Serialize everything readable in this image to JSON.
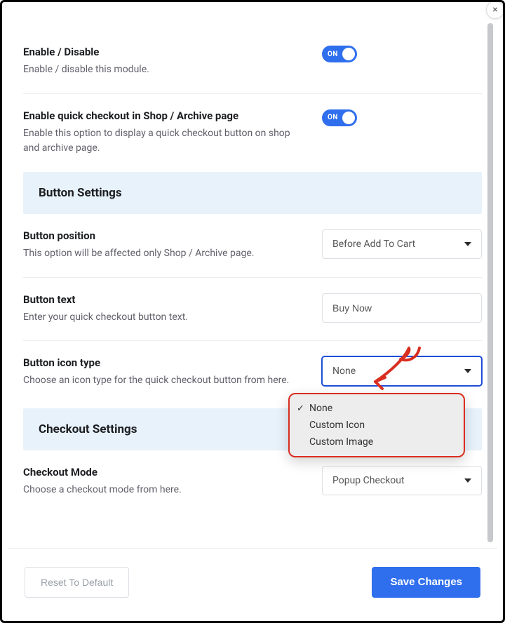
{
  "close_label": "×",
  "settings": {
    "enable_module": {
      "title": "Enable / Disable",
      "desc": "Enable / disable this module.",
      "toggle_text": "ON",
      "value": true
    },
    "enable_quick_checkout_archive": {
      "title": "Enable quick checkout in Shop / Archive page",
      "desc": "Enable this option to display a quick checkout button on shop and archive page.",
      "toggle_text": "ON",
      "value": true
    },
    "section_button_settings": "Button Settings",
    "button_position": {
      "title": "Button position",
      "desc": "This option will be affected only Shop / Archive page.",
      "value": "Before Add To Cart"
    },
    "button_text": {
      "title": "Button text",
      "desc": "Enter your quick checkout button text.",
      "value": "Buy Now"
    },
    "button_icon_type": {
      "title": "Button icon type",
      "desc": "Choose an icon type for the quick checkout button from here.",
      "value": "None",
      "options": [
        "None",
        "Custom Icon",
        "Custom Image"
      ],
      "selected_index": 0
    },
    "section_checkout_settings": "Checkout Settings",
    "checkout_mode": {
      "title": "Checkout Mode",
      "desc": "Choose a checkout mode from here.",
      "value": "Popup Checkout"
    }
  },
  "footer": {
    "reset_label": "Reset To Default",
    "save_label": "Save Changes"
  },
  "annotation": {
    "color": "#d92d20"
  }
}
